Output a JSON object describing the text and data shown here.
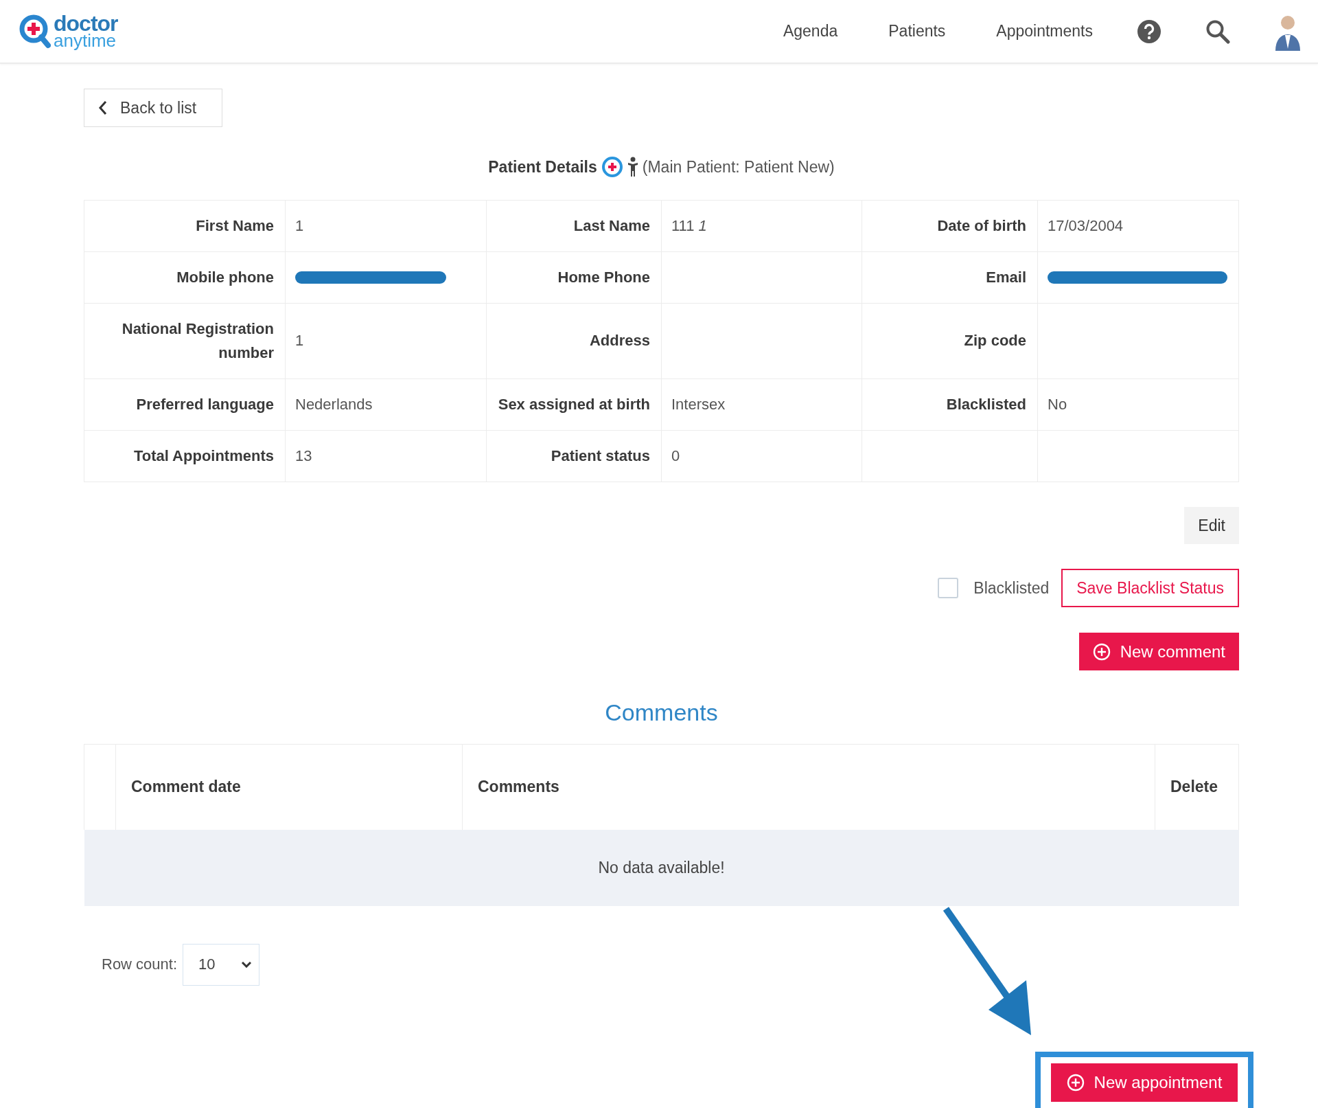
{
  "header": {
    "logo": {
      "line_1": "doctor",
      "line_2": "anytime"
    },
    "nav": [
      "Agenda",
      "Patients",
      "Appointments"
    ]
  },
  "back_button": "Back to list",
  "title": {
    "label": "Patient Details",
    "note": "(Main Patient: Patient New)"
  },
  "details": [
    [
      {
        "label": "First Name",
        "value": "1"
      },
      {
        "label": "Last Name",
        "value": "111 *1*"
      },
      {
        "label": "Date of birth",
        "value": "17/03/2004"
      }
    ],
    [
      {
        "label": "Mobile phone",
        "redacted": true
      },
      {
        "label": "Home Phone"
      },
      {
        "label": "Email",
        "redacted": true
      }
    ],
    [
      {
        "label": "National Registration number",
        "value": "1"
      },
      {
        "label": "Address"
      },
      {
        "label": "Zip code"
      }
    ],
    [
      {
        "label": "Preferred language",
        "value": "Nederlands"
      },
      {
        "label": "Sex assigned at birth",
        "value": "Intersex"
      },
      {
        "label": "Blacklisted",
        "value": "No"
      }
    ],
    [
      {
        "label": "Total Appointments",
        "value": "13"
      },
      {
        "label": "Patient status",
        "value": "0"
      }
    ]
  ],
  "edit_button": "Edit",
  "blacklist": {
    "label": "Blacklisted",
    "checked": false,
    "save_button": "Save Blacklist Status"
  },
  "new_comment_button": "New comment",
  "comments": {
    "title": "Comments",
    "columns": [
      "Comment date",
      "Comments",
      "Delete"
    ],
    "empty_text": "No data available!"
  },
  "row_count": {
    "label": "Row count:",
    "value": "10"
  },
  "new_appointment_button": "New appointment",
  "annotation": {
    "highlighted": true
  }
}
